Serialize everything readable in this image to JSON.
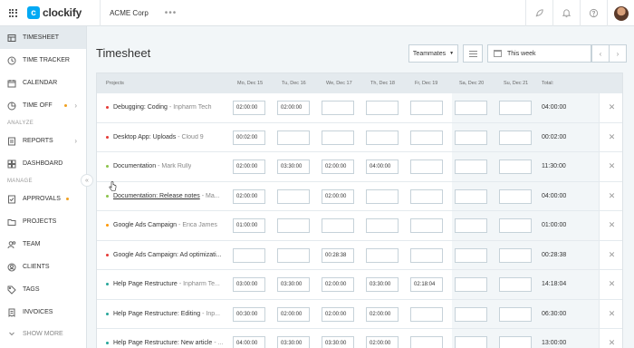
{
  "app": {
    "logo_letter": "c",
    "name": "clockify",
    "workspace": "ACME Corp",
    "more": "•••"
  },
  "topbar": {
    "icons": [
      "rocket-icon",
      "bell-icon",
      "help-icon"
    ]
  },
  "sidebar": {
    "items": [
      {
        "label": "TIMESHEET",
        "icon": "timesheet-icon",
        "active": true
      },
      {
        "label": "TIME TRACKER",
        "icon": "clock-icon"
      },
      {
        "label": "CALENDAR",
        "icon": "calendar-icon"
      },
      {
        "label": "TIME OFF",
        "icon": "time-off-icon",
        "badge": true,
        "chevron": true
      }
    ],
    "section_analyze": "ANALYZE",
    "analyze_items": [
      {
        "label": "REPORTS",
        "icon": "reports-icon",
        "chevron": true
      },
      {
        "label": "DASHBOARD",
        "icon": "dashboard-icon"
      }
    ],
    "section_manage": "MANAGE",
    "manage_items": [
      {
        "label": "APPROVALS",
        "icon": "approvals-icon",
        "badge": true
      },
      {
        "label": "PROJECTS",
        "icon": "projects-icon"
      },
      {
        "label": "TEAM",
        "icon": "team-icon"
      },
      {
        "label": "CLIENTS",
        "icon": "clients-icon"
      },
      {
        "label": "TAGS",
        "icon": "tags-icon"
      },
      {
        "label": "INVOICES",
        "icon": "invoices-icon"
      }
    ],
    "show_more": "SHOW MORE"
  },
  "main": {
    "title": "Timesheet",
    "teammates_label": "Teammates",
    "week_label": "This week",
    "prev_arrow": "‹",
    "next_arrow": "›"
  },
  "table": {
    "headers": [
      "Projects",
      "Mo, Dec 15",
      "Tu, Dec 16",
      "We, Dec 17",
      "Th, Dec 18",
      "Fr, Dec 19",
      "Sa, Dec 20",
      "Su, Dec 21",
      "Total:"
    ],
    "rows": [
      {
        "project": "Debugging: Coding",
        "client": "Inpharm Tech",
        "dot": "#e53935",
        "underline": false,
        "cells": [
          "02:00:00",
          "02:00:00",
          "",
          "",
          "",
          "",
          ""
        ],
        "total": "04:00:00"
      },
      {
        "project": "Desktop App: Uploads",
        "client": "Cloud 9",
        "dot": "#e53935",
        "underline": false,
        "cells": [
          "00:02:00",
          "",
          "",
          "",
          "",
          "",
          ""
        ],
        "total": "00:02:00"
      },
      {
        "project": "Documentation",
        "client": "Mark Rully",
        "dot": "#8bc34a",
        "underline": false,
        "cells": [
          "02:00:00",
          "03:30:00",
          "02:00:00",
          "04:00:00",
          "",
          "",
          ""
        ],
        "total": "11:30:00"
      },
      {
        "project": "Documentation: Release notes",
        "client": "Ma...",
        "dot": "#8bc34a",
        "underline": true,
        "cells": [
          "02:00:00",
          "",
          "02:00:00",
          "",
          "",
          "",
          ""
        ],
        "total": "04:00:00"
      },
      {
        "project": "Google Ads Campaign",
        "client": "Erica James",
        "dot": "#ff9800",
        "underline": false,
        "cells": [
          "01:00:00",
          "",
          "",
          "",
          "",
          "",
          ""
        ],
        "total": "01:00:00"
      },
      {
        "project": "Google Ads Campaign: Ad optimizati...",
        "client": "",
        "dot": "#e53935",
        "underline": false,
        "cells": [
          "",
          "",
          "00:28:38",
          "",
          "",
          "",
          ""
        ],
        "total": "00:28:38"
      },
      {
        "project": "Help Page Restructure",
        "client": "Inpharm Te...",
        "dot": "#26a69a",
        "underline": false,
        "cells": [
          "03:00:00",
          "03:30:00",
          "02:00:00",
          "03:30:00",
          "02:18:04",
          "",
          ""
        ],
        "total": "14:18:04"
      },
      {
        "project": "Help Page Restructure: Editing",
        "client": "Inp...",
        "dot": "#26a69a",
        "underline": false,
        "cells": [
          "00:30:00",
          "02:00:00",
          "02:00:00",
          "02:00:00",
          "",
          "",
          ""
        ],
        "total": "06:30:00"
      },
      {
        "project": "Help Page Restructure: New article",
        "client": "...",
        "dot": "#26a69a",
        "underline": false,
        "cells": [
          "04:00:00",
          "03:30:00",
          "03:30:00",
          "02:00:00",
          "",
          "",
          ""
        ],
        "total": "13:00:00"
      }
    ]
  }
}
